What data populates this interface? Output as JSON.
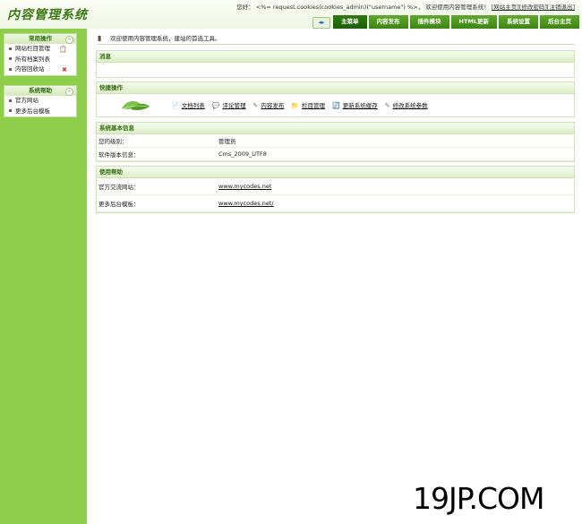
{
  "header": {
    "logo": "内容管理系统",
    "user_prefix": "您好：",
    "username_code": "<%= request.cookies(cookies_admin)(\"username\") %>，",
    "welcome_text": "欢迎使用内容管理系统！",
    "links": [
      "[网站主页]",
      "[修改密码]",
      "[注销退出]"
    ]
  },
  "nav": {
    "toggle_icon": "◂▸",
    "tabs": [
      "主菜单",
      "内容发布",
      "插件模块",
      "HTML更新",
      "系统设置",
      "后台主页"
    ]
  },
  "sidebar": {
    "panels": [
      {
        "title": "常用操作",
        "toggle": "«",
        "items": [
          {
            "label": "网站栏目管理",
            "icon": "📋"
          },
          {
            "label": "所有档案列表",
            "icon": ""
          },
          {
            "label": "内容回收站",
            "icon": "✖"
          }
        ]
      },
      {
        "title": "系统帮助",
        "toggle": "«",
        "items": [
          {
            "label": "官方网站"
          },
          {
            "label": "更多后台模板"
          }
        ]
      }
    ]
  },
  "main": {
    "welcome": "欢迎使用内容管理系统，建站的首选工具。",
    "message_title": "消息",
    "quick_title": "快捷操作",
    "quick_links": [
      {
        "label": "文档列表",
        "icon": "📄"
      },
      {
        "label": "评论管理",
        "icon": "💬"
      },
      {
        "label": "内容发布",
        "icon": "✎"
      },
      {
        "label": "栏目管理",
        "icon": "📁"
      },
      {
        "label": "更新系统缓存",
        "icon": "🔄"
      },
      {
        "label": "修改系统参数",
        "icon": "✎"
      }
    ],
    "sysinfo_title": "系统基本信息",
    "sysinfo_rows": [
      {
        "label": "您的级别：",
        "value": "管理员"
      },
      {
        "label": "软件版本信息：",
        "value": "Cms_2009_UTF8"
      }
    ],
    "help_title": "使用帮助",
    "help_rows": [
      {
        "label": "官方交流网站：",
        "value": "www.mycodes.net"
      },
      {
        "label": "更多后台模板：",
        "value": "www.mycodes.net/"
      }
    ]
  },
  "watermark": "19JP.COM",
  "colors": {
    "sidebar_bg": "#8fce4a",
    "tab_bg": "#4f9a1c",
    "tab_active": "#2e7a0e",
    "title_text": "#2f6d10"
  }
}
